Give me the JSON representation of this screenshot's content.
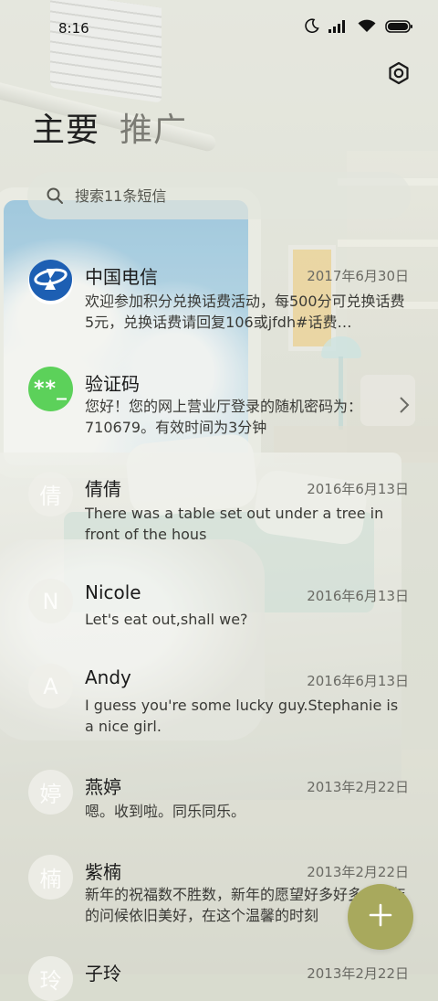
{
  "status_bar": {
    "time": "8:16",
    "icons": [
      "moon-icon",
      "signal-icon",
      "wifi-icon",
      "battery-icon"
    ]
  },
  "header": {
    "settings_icon": "gear-icon",
    "tabs": [
      {
        "label": "主要",
        "active": true
      },
      {
        "label": "推广",
        "active": false
      }
    ]
  },
  "search": {
    "placeholder": "搜索11条短信"
  },
  "messages": [
    {
      "avatar": "telecom-logo",
      "name": "中国电信",
      "date": "2017年6月30日",
      "preview": "欢迎参加积分兑换话费活动，每500分可兑换话费5元，兑换话费请回复106或jfdh#话费…"
    },
    {
      "avatar_text": "**_",
      "name": "验证码",
      "date": "",
      "preview": "您好！您的网上营业厅登录的随机密码为：710679。有效时间为3分钟"
    },
    {
      "avatar_text": "倩",
      "name": "倩倩",
      "date": "2016年6月13日",
      "preview": "There was a table set out under a tree in front of the hous"
    },
    {
      "avatar_text": "N",
      "name": "Nicole",
      "date": "2016年6月13日",
      "preview": "Let's eat out,shall we?"
    },
    {
      "avatar_text": "A",
      "name": "Andy",
      "date": "2016年6月13日",
      "preview": "I guess you're some lucky guy.Stephanie is a nice girl."
    },
    {
      "avatar_text": "婷",
      "name": "燕婷",
      "date": "2013年2月22日",
      "preview": "嗯。收到啦。同乐同乐。"
    },
    {
      "avatar_text": "楠",
      "name": "紫楠",
      "date": "2013年2月22日",
      "preview": "新年的祝福数不胜数，新年的愿望好多好多，新年的问候依旧美好，在这个温馨的时刻"
    },
    {
      "avatar_text": "玲",
      "name": "子玲",
      "date": "2013年2月22日",
      "preview": ""
    }
  ],
  "fab": {
    "icon": "plus-icon"
  },
  "colors": {
    "fab": "#a8a95d",
    "verification_avatar": "#5cd15a",
    "telecom_blue": "#1d5fb3"
  }
}
